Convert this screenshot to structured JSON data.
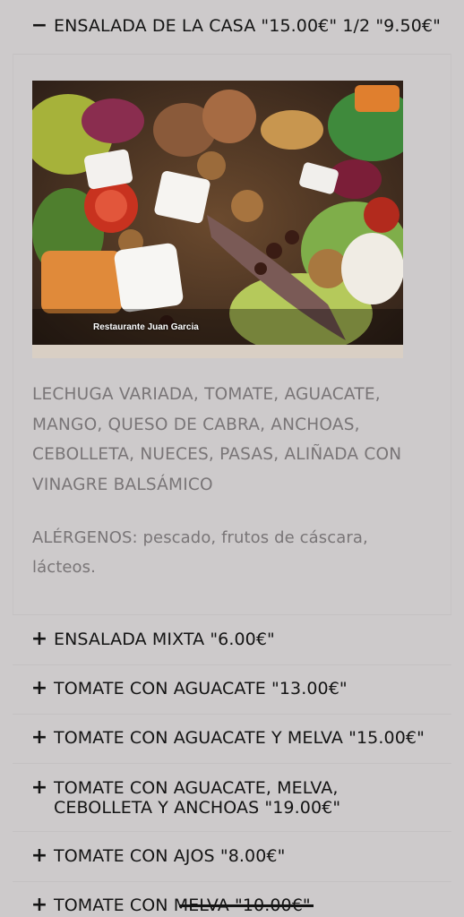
{
  "open_item": {
    "sign": "−",
    "title": "ENSALADA DE LA CASA \"15.00€\" 1/2 \"9.50€\"",
    "photo_caption": "Restaurante Juan Garcia",
    "description": "LECHUGA VARIADA, TOMATE, AGUACATE, MANGO, QUESO DE CABRA, ANCHOAS, CEBOLLETA, NUECES, PASAS, ALIÑADA CON VINAGRE BALSÁMICO",
    "allergens": "ALÉRGENOS: pescado, frutos de cáscara, lácteos."
  },
  "items": [
    {
      "sign": "+",
      "title": "ENSALADA MIXTA \"6.00€\""
    },
    {
      "sign": "+",
      "title": "TOMATE CON AGUACATE \"13.00€\""
    },
    {
      "sign": "+",
      "title": "TOMATE CON AGUACATE Y MELVA \"15.00€\""
    },
    {
      "sign": "+",
      "title": "TOMATE CON AGUACATE, MELVA, CEBOLLETA Y ANCHOAS \"19.00€\""
    },
    {
      "sign": "+",
      "title": "TOMATE CON AJOS \"8.00€\""
    },
    {
      "sign": "+",
      "title": "TOMATE CON MELVA \"10.00€\""
    }
  ],
  "icons": {
    "collapse": "minus-icon",
    "expand": "plus-icon"
  }
}
